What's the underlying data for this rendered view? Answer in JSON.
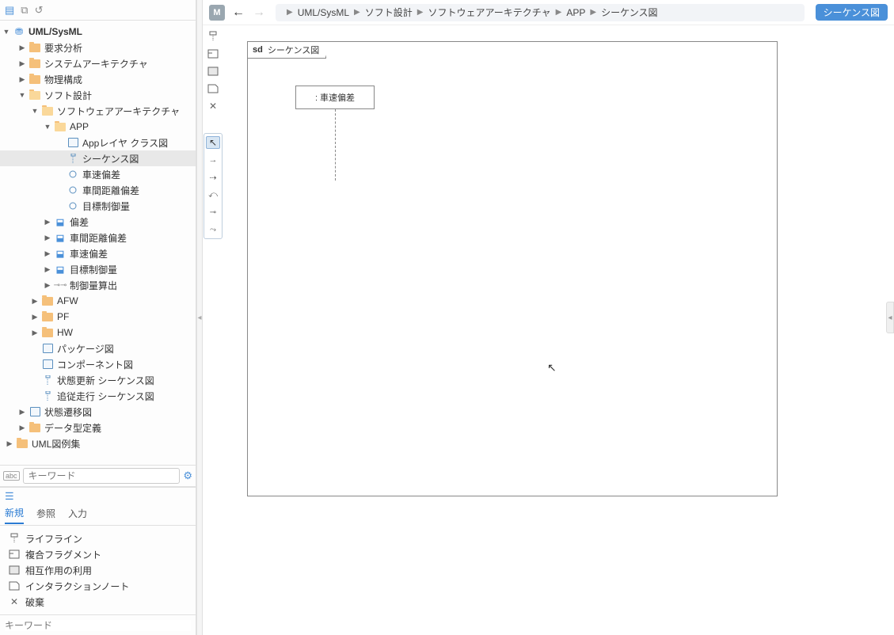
{
  "tree": {
    "root": "UML/SysML",
    "items": [
      {
        "label": "要求分析",
        "indent": 1,
        "icon": "folder",
        "toggle": "▶"
      },
      {
        "label": "システムアーキテクチャ",
        "indent": 1,
        "icon": "folder",
        "toggle": "▶"
      },
      {
        "label": "物理構成",
        "indent": 1,
        "icon": "folder",
        "toggle": "▶"
      },
      {
        "label": "ソフト設計",
        "indent": 1,
        "icon": "folder-open",
        "toggle": "▼"
      },
      {
        "label": "ソフトウェアアーキテクチャ",
        "indent": 2,
        "icon": "folder-open",
        "toggle": "▼"
      },
      {
        "label": "APP",
        "indent": 3,
        "icon": "folder-open",
        "toggle": "▼"
      },
      {
        "label": "Appレイヤ クラス図",
        "indent": 4,
        "icon": "diag",
        "toggle": ""
      },
      {
        "label": "シーケンス図",
        "indent": 4,
        "icon": "seq",
        "toggle": "",
        "selected": true
      },
      {
        "label": "車速偏差",
        "indent": 4,
        "icon": "iface",
        "toggle": ""
      },
      {
        "label": "車間距離偏差",
        "indent": 4,
        "icon": "iface",
        "toggle": ""
      },
      {
        "label": "目標制御量",
        "indent": 4,
        "icon": "iface",
        "toggle": ""
      },
      {
        "label": "偏差",
        "indent": 3,
        "icon": "blue",
        "toggle": "▶"
      },
      {
        "label": "車間距離偏差",
        "indent": 3,
        "icon": "blue",
        "toggle": "▶"
      },
      {
        "label": "車速偏差",
        "indent": 3,
        "icon": "blue",
        "toggle": "▶"
      },
      {
        "label": "目標制御量",
        "indent": 3,
        "icon": "blue",
        "toggle": "▶"
      },
      {
        "label": "制御量算出",
        "indent": 3,
        "icon": "op",
        "toggle": "▶"
      },
      {
        "label": "AFW",
        "indent": 2,
        "icon": "folder",
        "toggle": "▶"
      },
      {
        "label": "PF",
        "indent": 2,
        "icon": "folder",
        "toggle": "▶"
      },
      {
        "label": "HW",
        "indent": 2,
        "icon": "folder",
        "toggle": "▶"
      },
      {
        "label": "パッケージ図",
        "indent": 2,
        "icon": "diag",
        "toggle": ""
      },
      {
        "label": "コンポーネント図",
        "indent": 2,
        "icon": "diag",
        "toggle": ""
      },
      {
        "label": "状態更新 シーケンス図",
        "indent": 2,
        "icon": "seq",
        "toggle": ""
      },
      {
        "label": "追従走行 シーケンス図",
        "indent": 2,
        "icon": "seq",
        "toggle": ""
      },
      {
        "label": "状態遷移図",
        "indent": 1,
        "icon": "diag",
        "toggle": "▶"
      },
      {
        "label": "データ型定義",
        "indent": 1,
        "icon": "folder",
        "toggle": "▶"
      },
      {
        "label": "UML図例集",
        "indent": 0,
        "icon": "folder",
        "toggle": "▶",
        "bold": false
      }
    ]
  },
  "search": {
    "placeholder": "キーワード"
  },
  "bottom": {
    "tabs": [
      "新規",
      "参照",
      "入力"
    ],
    "activeTab": 0,
    "items": [
      {
        "label": "ライフライン",
        "icon": "lifeline"
      },
      {
        "label": "複合フラグメント",
        "icon": "fragment"
      },
      {
        "label": "相互作用の利用",
        "icon": "interaction"
      },
      {
        "label": "インタラクションノート",
        "icon": "note"
      },
      {
        "label": "破棄",
        "icon": "destroy"
      }
    ],
    "keywordPlaceholder": "キーワード"
  },
  "header": {
    "badge": "M",
    "breadcrumb": [
      "UML/SysML",
      "ソフト設計",
      "ソフトウェアアーキテクチャ",
      "APP",
      "シーケンス図"
    ],
    "diagramType": "シーケンス図"
  },
  "canvas": {
    "frameLabel": {
      "kind": "sd",
      "name": "シーケンス図"
    },
    "lifeline": {
      "name": ": 車速偏差"
    }
  }
}
